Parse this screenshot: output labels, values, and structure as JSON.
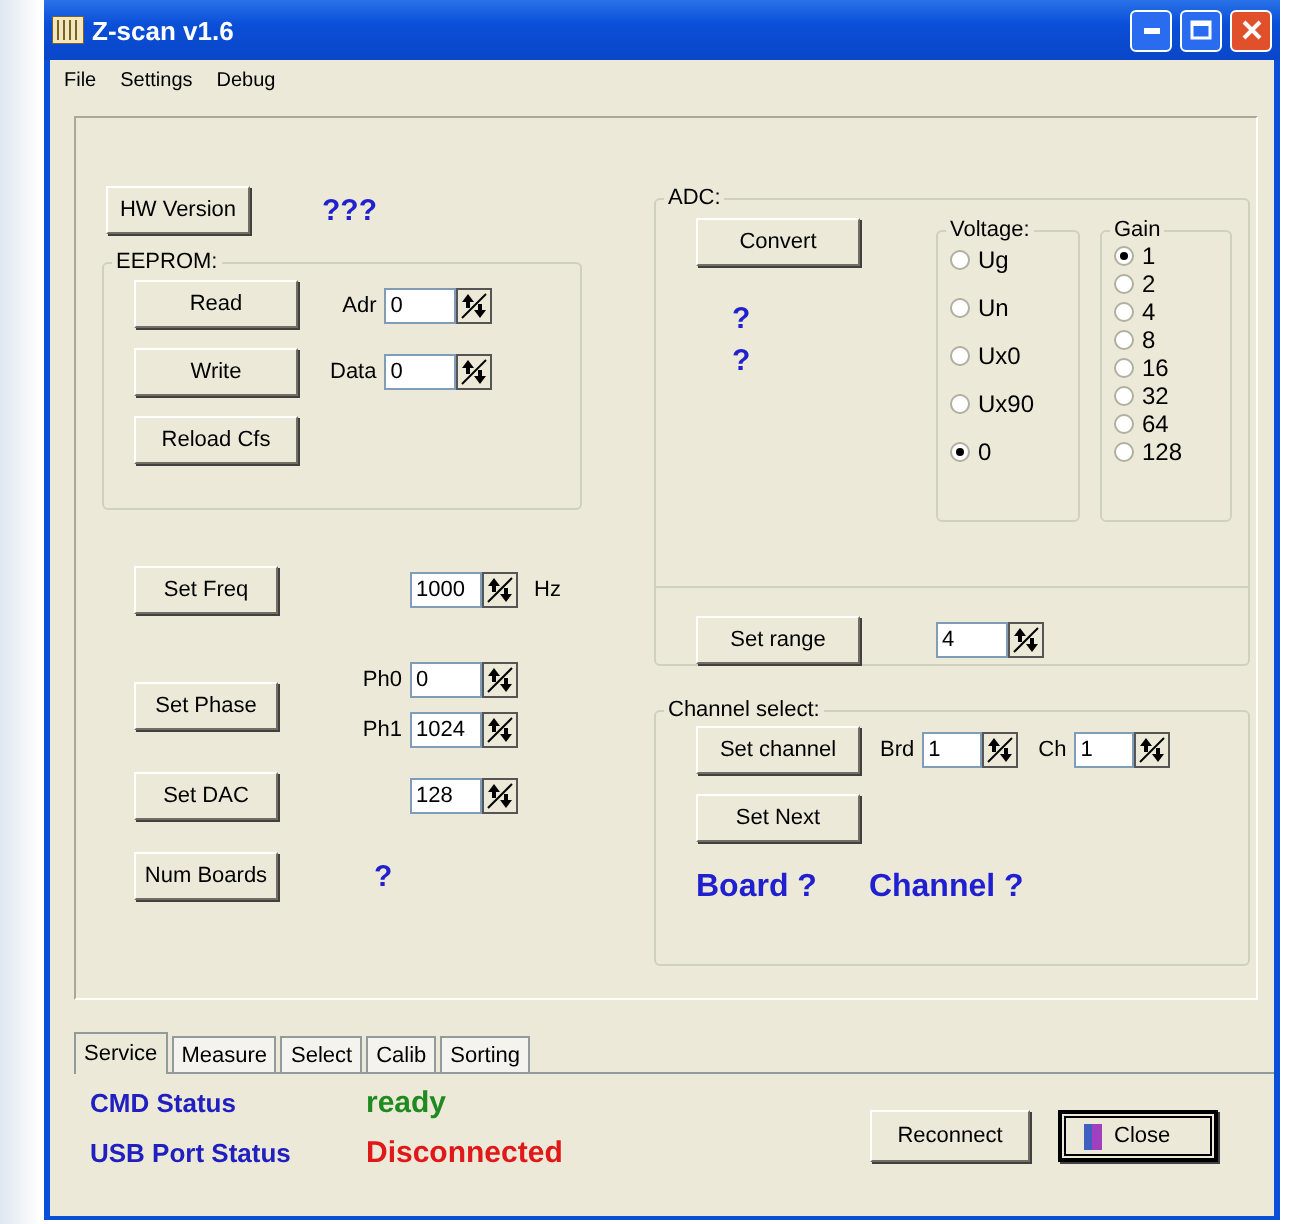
{
  "window": {
    "title": "Z-scan v1.6"
  },
  "menu": [
    "File",
    "Settings",
    "Debug"
  ],
  "hw_version": {
    "button": "HW Version",
    "value": "???"
  },
  "eeprom": {
    "title": "EEPROM:",
    "buttons": [
      "Read",
      "Write",
      "Reload Cfs"
    ],
    "fields": [
      {
        "label": "Adr",
        "value": "0"
      },
      {
        "label": "Data",
        "value": "0"
      }
    ]
  },
  "left_rows": [
    {
      "button": "Set Freq",
      "fields": [
        {
          "value": "1000"
        }
      ],
      "unit": "Hz"
    },
    {
      "button": "Set Phase",
      "fields": [
        {
          "label": "Ph0",
          "value": "0"
        },
        {
          "label": "Ph1",
          "value": "1024"
        }
      ]
    },
    {
      "button": "Set DAC",
      "fields": [
        {
          "value": "128"
        }
      ]
    },
    {
      "button": "Num Boards",
      "result": "?"
    }
  ],
  "adc": {
    "title": "ADC:",
    "button": "Convert",
    "results": [
      "?",
      "?"
    ],
    "voltage": {
      "title": "Voltage:",
      "options": [
        {
          "label": "Ug",
          "selected": false
        },
        {
          "label": "Un",
          "selected": false
        },
        {
          "label": "Ux0",
          "selected": false
        },
        {
          "label": "Ux90",
          "selected": false
        },
        {
          "label": "0",
          "selected": true
        }
      ]
    },
    "gain": {
      "title": "Gain",
      "options": [
        {
          "label": "1",
          "selected": true
        },
        {
          "label": "2",
          "selected": false
        },
        {
          "label": "4",
          "selected": false
        },
        {
          "label": "8",
          "selected": false
        },
        {
          "label": "16",
          "selected": false
        },
        {
          "label": "32",
          "selected": false
        },
        {
          "label": "64",
          "selected": false
        },
        {
          "label": "128",
          "selected": false
        }
      ]
    },
    "range": {
      "button": "Set range",
      "value": "4"
    }
  },
  "channel_select": {
    "title": "Channel select:",
    "button": "Set channel",
    "fields": [
      {
        "label": "Brd",
        "value": "1"
      },
      {
        "label": "Ch",
        "value": "1"
      }
    ],
    "next_button": "Set Next",
    "results": [
      "Board ?",
      "Channel ?"
    ]
  },
  "tabs": [
    {
      "label": "Service",
      "selected": true
    },
    {
      "label": "Measure",
      "selected": false
    },
    {
      "label": "Select",
      "selected": false
    },
    {
      "label": "Calib",
      "selected": false
    },
    {
      "label": "Sorting",
      "selected": false
    }
  ],
  "status": [
    {
      "label": "CMD Status",
      "value": "ready",
      "color": "#1f8a1f"
    },
    {
      "label": "USB Port Status",
      "value": "Disconnected",
      "color": "#e01818"
    }
  ],
  "buttons": [
    {
      "label": "Reconnect",
      "default": false
    },
    {
      "label": "Close",
      "default": true
    }
  ]
}
